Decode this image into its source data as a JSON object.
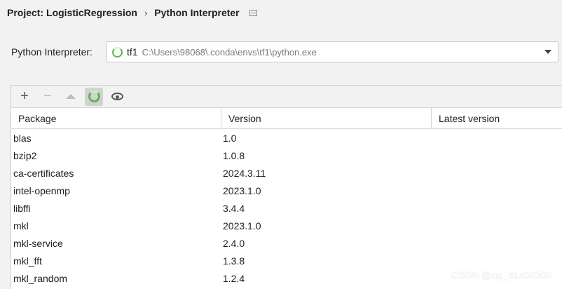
{
  "breadcrumb": {
    "project": "Project: LogisticRegression",
    "separator": "›",
    "page": "Python Interpreter"
  },
  "interpreter": {
    "label": "Python Interpreter:",
    "name": "tf1",
    "path": "C:\\Users\\98068\\.conda\\envs\\tf1\\python.exe"
  },
  "toolbar": {
    "add": "+",
    "remove": "−"
  },
  "table": {
    "headers": [
      "Package",
      "Version",
      "Latest version"
    ],
    "rows": [
      {
        "package": "blas",
        "version": "1.0",
        "latest": ""
      },
      {
        "package": "bzip2",
        "version": "1.0.8",
        "latest": ""
      },
      {
        "package": "ca-certificates",
        "version": "2024.3.11",
        "latest": ""
      },
      {
        "package": "intel-openmp",
        "version": "2023.1.0",
        "latest": ""
      },
      {
        "package": "libffi",
        "version": "3.4.4",
        "latest": ""
      },
      {
        "package": "mkl",
        "version": "2023.1.0",
        "latest": ""
      },
      {
        "package": "mkl-service",
        "version": "2.4.0",
        "latest": ""
      },
      {
        "package": "mkl_fft",
        "version": "1.3.8",
        "latest": ""
      },
      {
        "package": "mkl_random",
        "version": "1.2.4",
        "latest": ""
      }
    ]
  },
  "watermark": "CSDN @qq_41404300",
  "colors": {
    "accent_green": "#58b848",
    "background": "#f2f2f2"
  }
}
